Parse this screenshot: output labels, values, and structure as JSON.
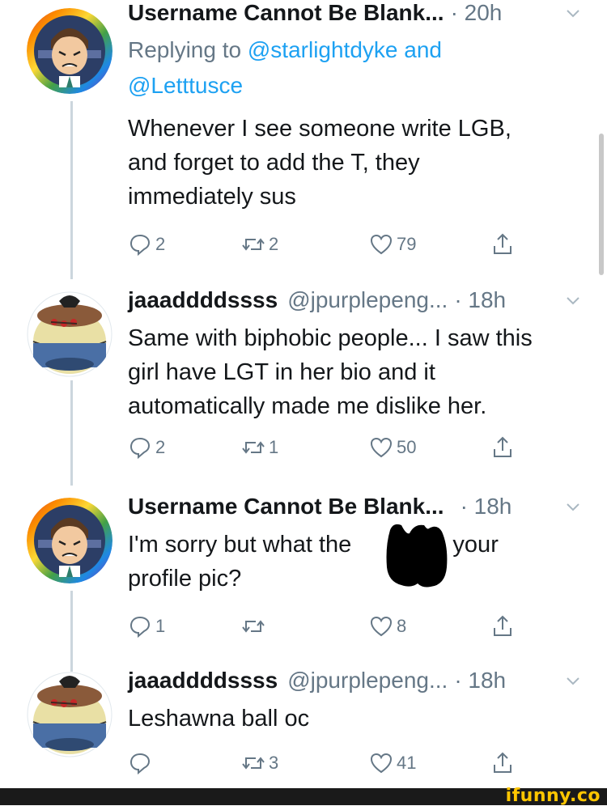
{
  "tweets": [
    {
      "name": "Username Cannot Be Blank...",
      "handle": "",
      "time": "· 20h",
      "reply_prefix": "Replying to ",
      "reply_user1": "@starlightdyke",
      "reply_and": " and",
      "reply_user2": "@Letttusce",
      "body": "Whenever I see someone write LGB, and forget to add the T, they immediately sus",
      "replies": "2",
      "retweets": "2",
      "likes": "79"
    },
    {
      "name": "jaaaddddssss",
      "handle": "@jpurplepeng...",
      "time": "· 18h",
      "body": "Same with biphobic people... I saw this girl have LGT in her bio and it automatically made me dislike her.",
      "replies": "2",
      "retweets": "1",
      "likes": "50"
    },
    {
      "name": "Username Cannot Be Blank...",
      "handle": "",
      "time": "· 18h",
      "body_before": "I'm sorry but what the ",
      "body_after": " is your profile pic?",
      "replies": "1",
      "retweets": "",
      "likes": "8"
    },
    {
      "name": "jaaaddddssss",
      "handle": "@jpurplepeng...",
      "time": "· 18h",
      "body": "Leshawna ball oc",
      "replies": "",
      "retweets": "3",
      "likes": "41"
    }
  ],
  "watermark": "ifunny.co",
  "colors": {
    "link": "#1da1f2",
    "muted": "#657786",
    "text": "#14171a",
    "thread": "#ccd6dd"
  }
}
